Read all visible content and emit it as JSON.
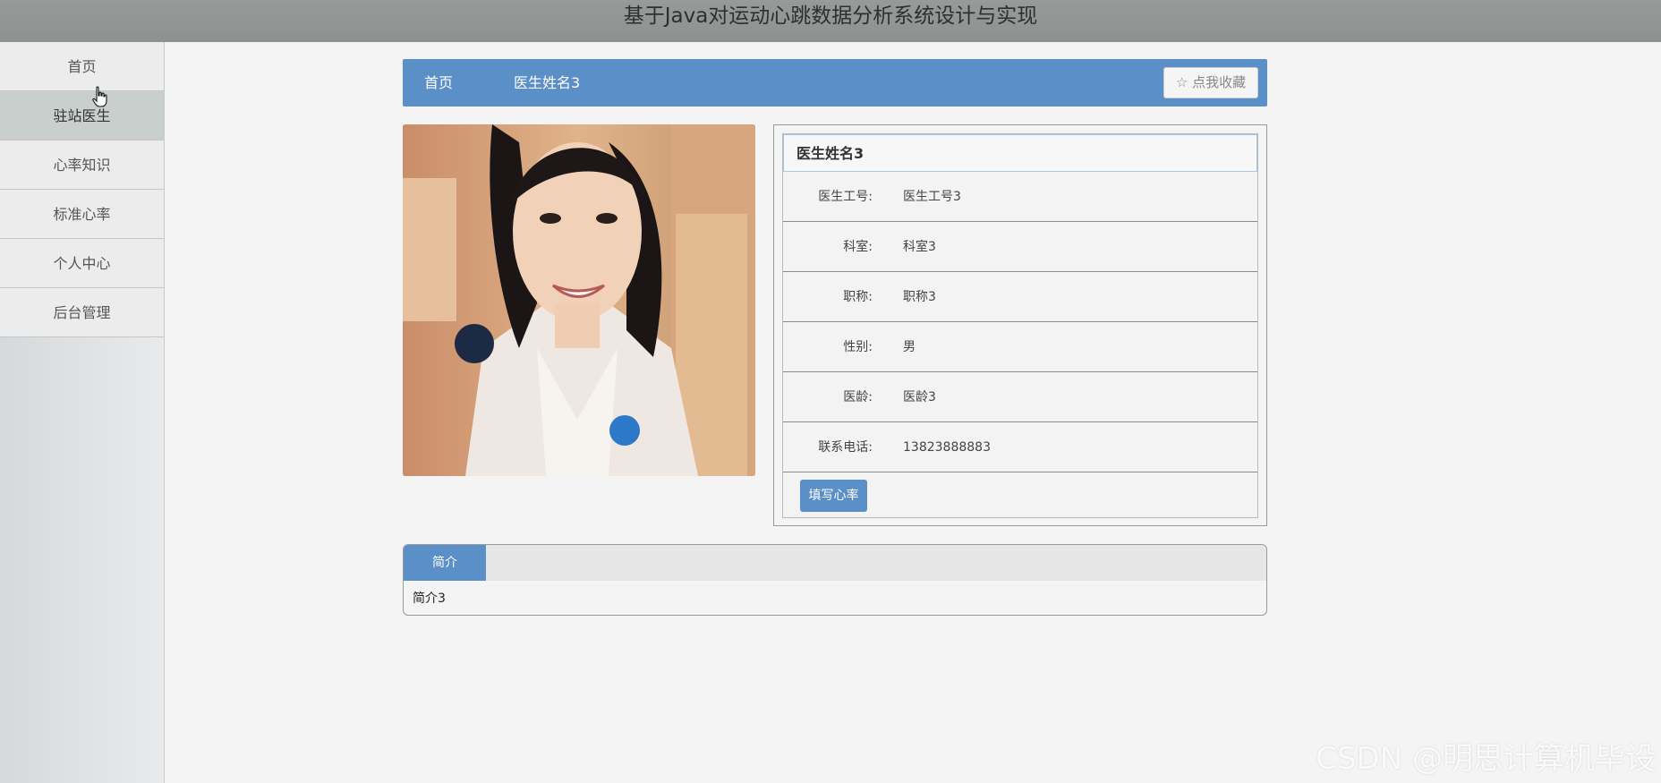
{
  "header": {
    "title": "基于Java对运动心跳数据分析系统设计与实现"
  },
  "sidebar": {
    "items": [
      {
        "label": "首页"
      },
      {
        "label": "驻站医生"
      },
      {
        "label": "心率知识"
      },
      {
        "label": "标准心率"
      },
      {
        "label": "个人中心"
      },
      {
        "label": "后台管理"
      }
    ],
    "active_index": 1
  },
  "breadcrumb": {
    "home": "首页",
    "current": "医生姓名3"
  },
  "favorite_button": {
    "icon": "star-outline-icon",
    "label": "点我收藏"
  },
  "doctor": {
    "name": "医生姓名3",
    "fields": [
      {
        "label": "医生工号:",
        "value": "医生工号3"
      },
      {
        "label": "科室:",
        "value": "科室3"
      },
      {
        "label": "职称:",
        "value": "职称3"
      },
      {
        "label": "性别:",
        "value": "男"
      },
      {
        "label": "医龄:",
        "value": "医龄3"
      },
      {
        "label": "联系电话:",
        "value": "13823888883"
      }
    ],
    "action_button": "填写心率"
  },
  "tabs": {
    "active_label": "简介",
    "content": "简介3"
  },
  "watermark": "CSDN @明思计算机毕设",
  "colors": {
    "accent": "#5b8fc7",
    "topbar": "#929594"
  }
}
